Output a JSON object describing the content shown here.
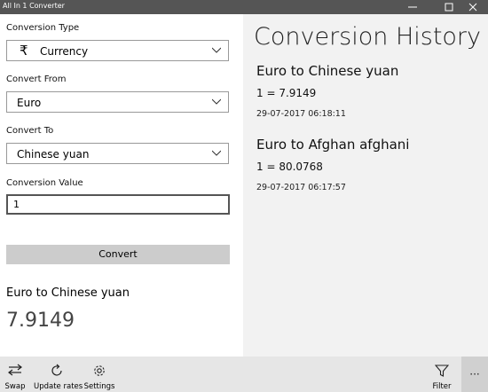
{
  "window": {
    "title": "All In 1 Converter"
  },
  "form": {
    "conversion_type_label": "Conversion Type",
    "conversion_type_value": "Currency",
    "conversion_type_icon": "rupee-icon",
    "convert_from_label": "Convert From",
    "convert_from_value": "Euro",
    "convert_to_label": "Convert To",
    "convert_to_value": "Chinese yuan",
    "conversion_value_label": "Conversion Value",
    "conversion_value": "1",
    "convert_button_label": "Convert"
  },
  "result": {
    "title": "Euro to Chinese yuan",
    "value": "7.9149"
  },
  "history": {
    "heading": "Conversion History",
    "items": [
      {
        "title": "Euro to Chinese yuan",
        "rate": "1 = 7.9149",
        "date": "29-07-2017 06:18:11"
      },
      {
        "title": "Euro to Afghan afghani",
        "rate": "1 = 80.0768",
        "date": "29-07-2017 06:17:57"
      }
    ]
  },
  "appbar": {
    "swap_label": "Swap",
    "update_rates_label": "Update rates",
    "settings_label": "Settings",
    "filter_label": "Filter",
    "more_label": "···"
  },
  "icons": {
    "swap": "swap-icon",
    "update_rates": "refresh-icon",
    "settings": "gear-icon",
    "filter": "filter-icon",
    "more": "more-icon"
  },
  "colors": {
    "titlebar": "#555555",
    "history_bg": "#f2f2f2",
    "convert_button": "#cccccc",
    "appbar": "#e6e6e6"
  }
}
